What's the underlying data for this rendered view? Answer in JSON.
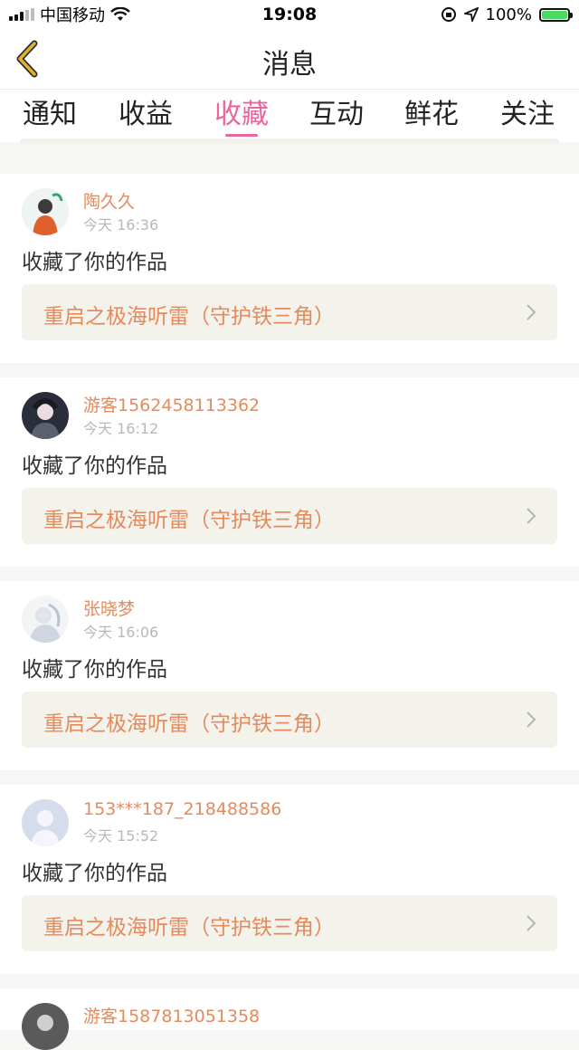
{
  "status_bar": {
    "carrier": "中国移动",
    "time": "19:08",
    "battery": "100%"
  },
  "nav": {
    "title": "消息"
  },
  "tabs": [
    {
      "label": "通知"
    },
    {
      "label": "收益"
    },
    {
      "label": "收藏",
      "active": true
    },
    {
      "label": "互动"
    },
    {
      "label": "鲜花"
    },
    {
      "label": "关注"
    }
  ],
  "messages": [
    {
      "username": "陶久久",
      "time": "今天 16:36",
      "action": "收藏了你的作品",
      "work": "重启之极海听雷（守护铁三角）"
    },
    {
      "username": "游客1562458113362",
      "time": "今天 16:12",
      "action": "收藏了你的作品",
      "work": "重启之极海听雷（守护铁三角）"
    },
    {
      "username": "张晓梦",
      "time": "今天 16:06",
      "action": "收藏了你的作品",
      "work": "重启之极海听雷（守护铁三角）"
    },
    {
      "username": "153***187_218488586",
      "time": "今天 15:52",
      "action": "收藏了你的作品",
      "work": "重启之极海听雷（守护铁三角）"
    },
    {
      "username": "游客1587813051358",
      "time": "",
      "action": "",
      "work": ""
    }
  ],
  "colors": {
    "accent": "#e8679d",
    "username": "#e58a5c",
    "back_icon": "#e0b12a"
  }
}
